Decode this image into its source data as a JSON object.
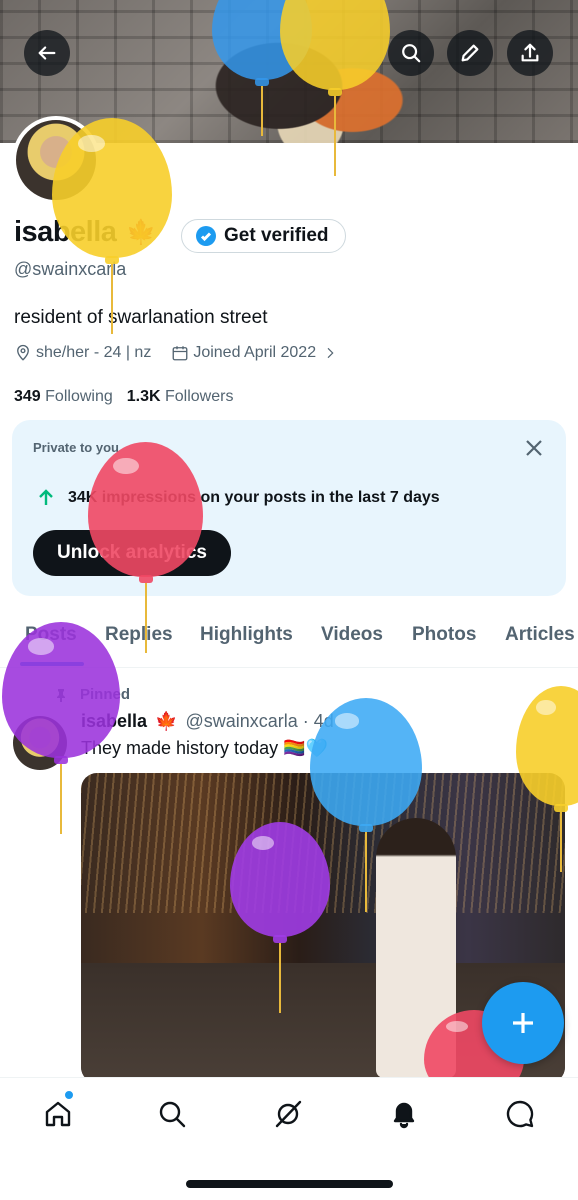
{
  "profile": {
    "name": "isabella",
    "name_emoji": "🍁",
    "handle": "@swainxcarla",
    "get_verified_label": "Get verified",
    "bio": "resident of swarlanation street",
    "location": "she/her - 24 | nz",
    "joined": "Joined April 2022",
    "following_count": "349",
    "following_label": "Following",
    "followers_count": "1.3K",
    "followers_label": "Followers"
  },
  "analytics_card": {
    "private_label": "Private to you",
    "impressions_text": "34K impressions on your posts in the last 7 days",
    "unlock_label": "Unlock analytics"
  },
  "tabs": [
    "Posts",
    "Replies",
    "Highlights",
    "Videos",
    "Photos",
    "Articles"
  ],
  "active_tab": "Posts",
  "post": {
    "pinned_label": "Pinned",
    "author": "isabella",
    "author_emoji": "🍁",
    "handle_time": "@swainxcarla · 4d",
    "text": "They made history today 🏳️‍🌈🩵"
  },
  "icons": {
    "back": "back-arrow-icon",
    "search": "search-icon",
    "edit": "edit-pencil-icon",
    "share": "share-upload-icon",
    "nav": [
      "home-icon",
      "search-icon",
      "grok-icon",
      "notifications-bell-icon",
      "messages-icon"
    ],
    "compose": "plus-icon"
  },
  "colors": {
    "accent": "#1d9bf0",
    "text": "#0f1419",
    "muted": "#536471",
    "positive": "#00ba7c",
    "card_bg": "#e8f5fd"
  }
}
